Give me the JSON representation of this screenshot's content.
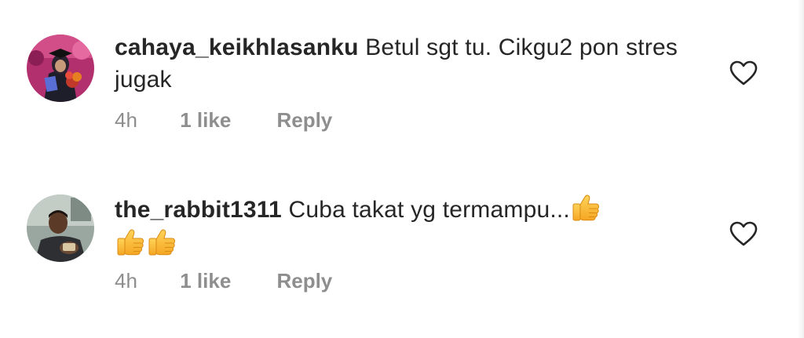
{
  "comments": [
    {
      "username": "cahaya_keikhlasanku",
      "text": "Betul sgt tu. Cikgu2 pon stres jugak",
      "time": "4h",
      "likes": "1 like",
      "reply_label": "Reply",
      "avatar_icon": "profile-photo-graduation",
      "like_icon": "heart-outline-icon"
    },
    {
      "username": "the_rabbit1311",
      "text": "Cuba takat yg termampu...",
      "emojis": [
        "thumbs-up",
        "thumbs-up",
        "thumbs-up"
      ],
      "time": "4h",
      "likes": "1 like",
      "reply_label": "Reply",
      "avatar_icon": "profile-photo-man",
      "like_icon": "heart-outline-icon"
    }
  ],
  "colors": {
    "text": "#262626",
    "secondary": "#8e8e8e",
    "background": "#ffffff"
  }
}
